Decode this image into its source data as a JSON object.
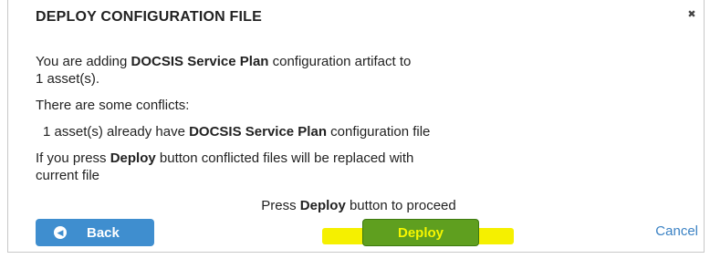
{
  "dialog": {
    "title": "DEPLOY CONFIGURATION FILE",
    "close_glyph": "✖",
    "para1": {
      "pre": "You are adding ",
      "bold": "DOCSIS Service Plan",
      "post": " configuration artifact to",
      "line2": "1 asset(s)."
    },
    "conflicts_heading": "There are some conflicts:",
    "conflict_line": {
      "pre": "1 asset(s) already have ",
      "bold": "DOCSIS Service Plan",
      "post": " configuration file"
    },
    "warning": {
      "pre": "If you press ",
      "bold": "Deploy",
      "post": " button conflicted files will be replaced with",
      "line2": "current file"
    },
    "proceed": {
      "pre": "Press ",
      "bold": "Deploy",
      "post": " button to proceed"
    },
    "buttons": {
      "back": "Back",
      "back_icon": "◀",
      "deploy": "Deploy",
      "cancel": "Cancel"
    }
  },
  "colors": {
    "back_button": "#3f8ecf",
    "deploy_button": "#5f9f1f",
    "highlight": "#f5f000",
    "link": "#3b82c4"
  }
}
